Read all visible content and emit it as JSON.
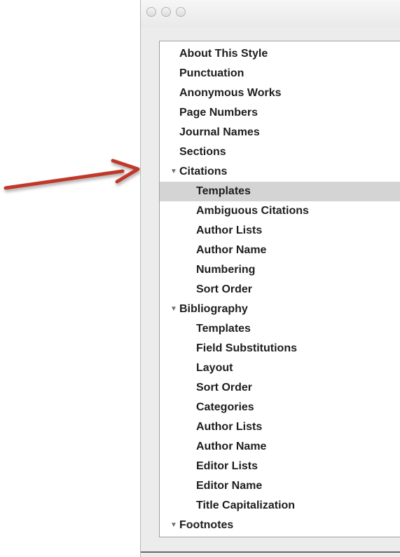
{
  "window": {
    "title": ""
  },
  "outline": {
    "items": [
      {
        "label": "About This Style",
        "type": "item",
        "level": 0
      },
      {
        "label": "Punctuation",
        "type": "item",
        "level": 0
      },
      {
        "label": "Anonymous Works",
        "type": "item",
        "level": 0
      },
      {
        "label": "Page Numbers",
        "type": "item",
        "level": 0
      },
      {
        "label": "Journal Names",
        "type": "item",
        "level": 0
      },
      {
        "label": "Sections",
        "type": "item",
        "level": 0
      },
      {
        "label": "Citations",
        "type": "group",
        "level": 0,
        "expanded": true
      },
      {
        "label": "Templates",
        "type": "item",
        "level": 1,
        "selected": true
      },
      {
        "label": "Ambiguous Citations",
        "type": "item",
        "level": 1
      },
      {
        "label": "Author Lists",
        "type": "item",
        "level": 1
      },
      {
        "label": "Author Name",
        "type": "item",
        "level": 1
      },
      {
        "label": "Numbering",
        "type": "item",
        "level": 1
      },
      {
        "label": "Sort Order",
        "type": "item",
        "level": 1
      },
      {
        "label": "Bibliography",
        "type": "group",
        "level": 0,
        "expanded": true
      },
      {
        "label": "Templates",
        "type": "item",
        "level": 1
      },
      {
        "label": "Field Substitutions",
        "type": "item",
        "level": 1
      },
      {
        "label": "Layout",
        "type": "item",
        "level": 1
      },
      {
        "label": "Sort Order",
        "type": "item",
        "level": 1
      },
      {
        "label": "Categories",
        "type": "item",
        "level": 1
      },
      {
        "label": "Author Lists",
        "type": "item",
        "level": 1
      },
      {
        "label": "Author Name",
        "type": "item",
        "level": 1
      },
      {
        "label": "Editor Lists",
        "type": "item",
        "level": 1
      },
      {
        "label": "Editor Name",
        "type": "item",
        "level": 1
      },
      {
        "label": "Title Capitalization",
        "type": "item",
        "level": 1
      },
      {
        "label": "Footnotes",
        "type": "group",
        "level": 0,
        "expanded": true
      }
    ]
  },
  "disclosure_glyph": "▼",
  "colors": {
    "selection": "#d4d4d4",
    "annotation_arrow": "#c0392b"
  }
}
